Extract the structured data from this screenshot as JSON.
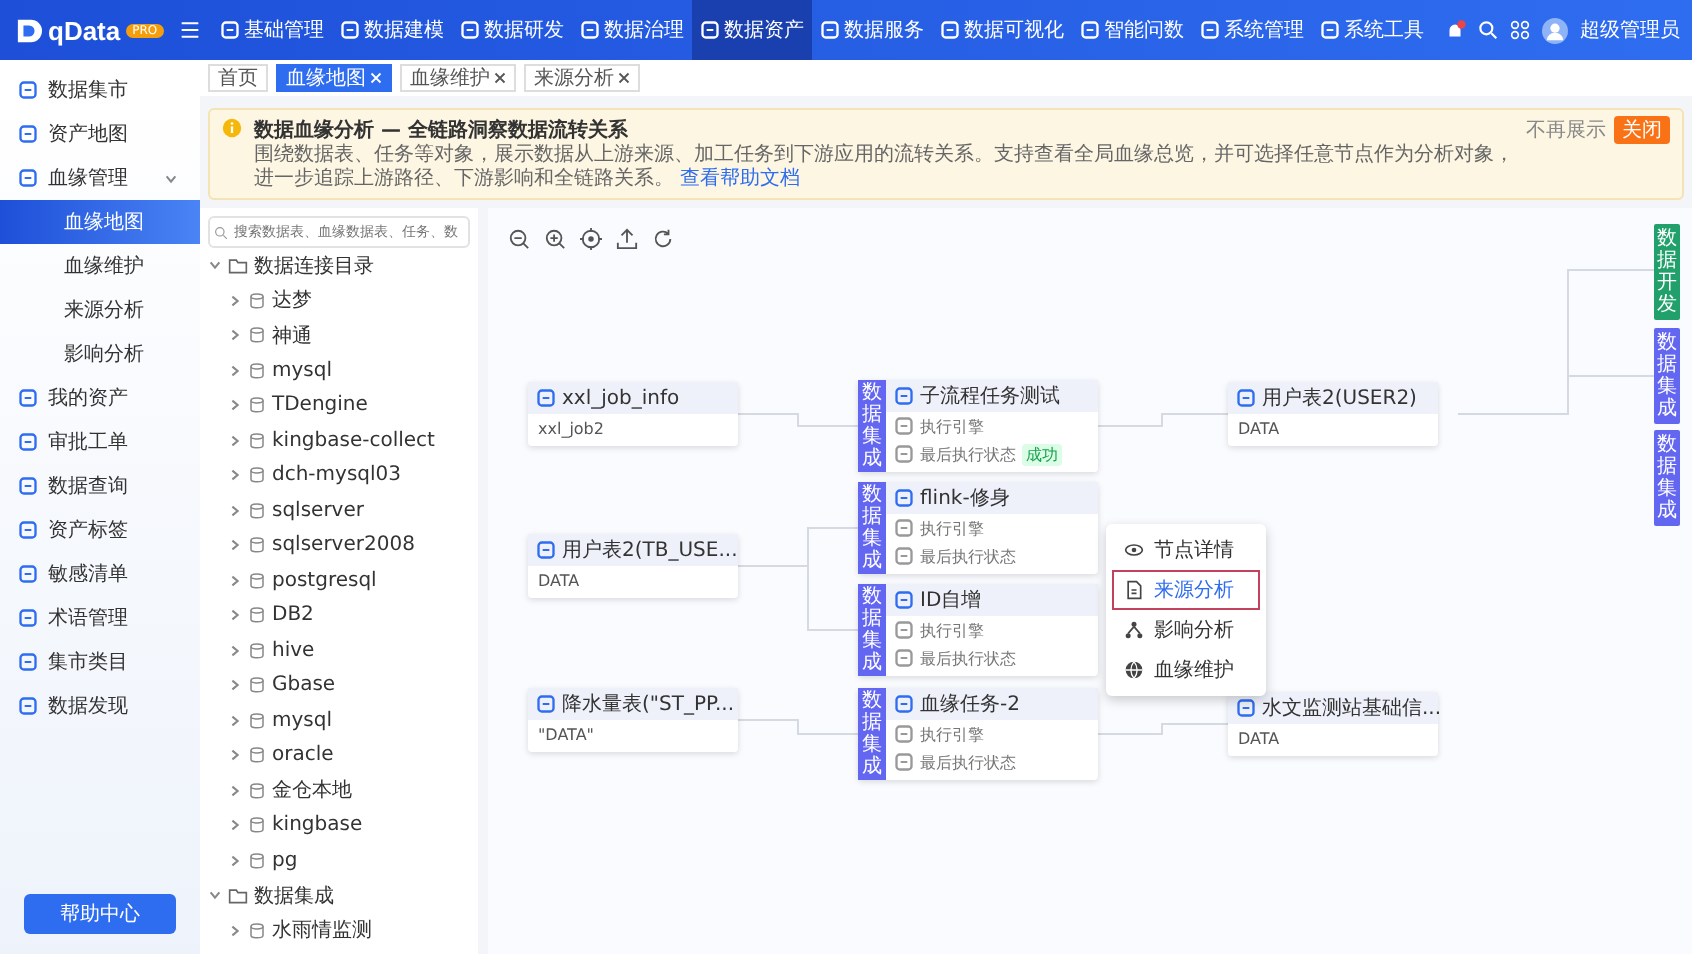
{
  "brand": {
    "name": "qData",
    "badge": "PRO"
  },
  "nav": {
    "items": [
      {
        "label": "基础管理",
        "selected": false
      },
      {
        "label": "数据建模",
        "selected": false
      },
      {
        "label": "数据研发",
        "selected": false
      },
      {
        "label": "数据治理",
        "selected": false
      },
      {
        "label": "数据资产",
        "selected": true
      },
      {
        "label": "数据服务",
        "selected": false
      },
      {
        "label": "数据可视化",
        "selected": false
      },
      {
        "label": "智能问数",
        "selected": false
      },
      {
        "label": "系统管理",
        "selected": false
      },
      {
        "label": "系统工具",
        "selected": false
      }
    ],
    "user": "超级管理员"
  },
  "sidebar": {
    "items": [
      {
        "label": "数据集市",
        "selected": false
      },
      {
        "label": "资产地图",
        "selected": false
      },
      {
        "label": "血缘管理",
        "selected": false,
        "expanded": true,
        "children": [
          {
            "label": "血缘地图",
            "selected": true
          },
          {
            "label": "血缘维护",
            "selected": false
          },
          {
            "label": "来源分析",
            "selected": false
          },
          {
            "label": "影响分析",
            "selected": false
          }
        ]
      },
      {
        "label": "我的资产",
        "selected": false
      },
      {
        "label": "审批工单",
        "selected": false
      },
      {
        "label": "数据查询",
        "selected": false
      },
      {
        "label": "资产标签",
        "selected": false
      },
      {
        "label": "敏感清单",
        "selected": false
      },
      {
        "label": "术语管理",
        "selected": false
      },
      {
        "label": "集市类目",
        "selected": false
      },
      {
        "label": "数据发现",
        "selected": false
      }
    ],
    "help": "帮助中心"
  },
  "tabs": [
    {
      "label": "首页",
      "selected": false,
      "closable": false
    },
    {
      "label": "血缘地图",
      "selected": true,
      "closable": true
    },
    {
      "label": "血缘维护",
      "selected": false,
      "closable": true
    },
    {
      "label": "来源分析",
      "selected": false,
      "closable": true
    }
  ],
  "notice": {
    "title": "数据血缘分析 — 全链路洞察数据流转关系",
    "text": "围绕数据表、任务等对象，展示数据从上游来源、加工任务到下游应用的流转关系。支持查看全局血缘总览，并可选择任意节点作为分析对象，进一步追踪上游路径、下游影响和全链路关系。",
    "link": "查看帮助文档",
    "dismiss": "不再展示",
    "close": "关闭"
  },
  "tree": {
    "placeholder": "搜索数据表、血缘数据表、任务、数",
    "groups": [
      {
        "label": "数据连接目录",
        "expanded": true,
        "children": [
          {
            "label": "达梦",
            "expanded": false
          },
          {
            "label": "神通",
            "expanded": false
          },
          {
            "label": "mysql",
            "expanded": false
          },
          {
            "label": "TDengine",
            "expanded": false
          },
          {
            "label": "kingbase-collect",
            "expanded": false
          },
          {
            "label": "dch-mysql03",
            "expanded": false
          },
          {
            "label": "sqlserver",
            "expanded": false
          },
          {
            "label": "sqlserver2008",
            "expanded": false
          },
          {
            "label": "postgresql",
            "expanded": false
          },
          {
            "label": "DB2",
            "expanded": false
          },
          {
            "label": "hive",
            "expanded": false
          },
          {
            "label": "Gbase",
            "expanded": false
          },
          {
            "label": "mysql",
            "expanded": false
          },
          {
            "label": "oracle",
            "expanded": false
          },
          {
            "label": "金仓本地",
            "expanded": false
          },
          {
            "label": "kingbase",
            "expanded": false
          },
          {
            "label": "pg",
            "expanded": false
          }
        ]
      },
      {
        "label": "数据集成",
        "expanded": true,
        "children": [
          {
            "label": "水雨情监测",
            "expanded": false
          }
        ]
      }
    ]
  },
  "canvas": {
    "source_nodes": [
      {
        "title": "xxl_job_info",
        "field": "xxl_job2"
      },
      {
        "title": "用户表2(TB_USE...",
        "field": "DATA"
      },
      {
        "title": "降水量表(\"ST_PP...",
        "field": "\"DATA\""
      }
    ],
    "task_nodes": [
      {
        "side_label": "数据集成",
        "title": "子流程任务测试",
        "rows": [
          {
            "label": "执行引擎"
          },
          {
            "label": "最后执行状态",
            "tag": "成功"
          }
        ]
      },
      {
        "side_label": "数据集成",
        "title": "flink-修身",
        "rows": [
          {
            "label": "执行引擎"
          },
          {
            "label": "最后执行状态"
          }
        ]
      },
      {
        "side_label": "数据集成",
        "title": "ID自增",
        "rows": [
          {
            "label": "执行引擎"
          },
          {
            "label": "最后执行状态"
          }
        ]
      },
      {
        "side_label": "数据集成",
        "title": "血缘任务-2",
        "rows": [
          {
            "label": "执行引擎"
          },
          {
            "label": "最后执行状态"
          }
        ]
      }
    ],
    "target_nodes": [
      {
        "title": "用户表2(USER2)",
        "field": "DATA"
      },
      {
        "title": "水文监测站基础信...",
        "field": "DATA"
      }
    ],
    "side_tags": [
      {
        "label": "数据开发",
        "color": "#22a06b"
      },
      {
        "label": "数据集成",
        "color": "#6366f1"
      },
      {
        "label": "数据集成",
        "color": "#6366f1"
      }
    ],
    "context_menu": {
      "items": [
        {
          "label": "节点详情",
          "selected": false
        },
        {
          "label": "来源分析",
          "selected": true
        },
        {
          "label": "影响分析",
          "selected": false
        },
        {
          "label": "血缘维护",
          "selected": false
        }
      ]
    }
  }
}
